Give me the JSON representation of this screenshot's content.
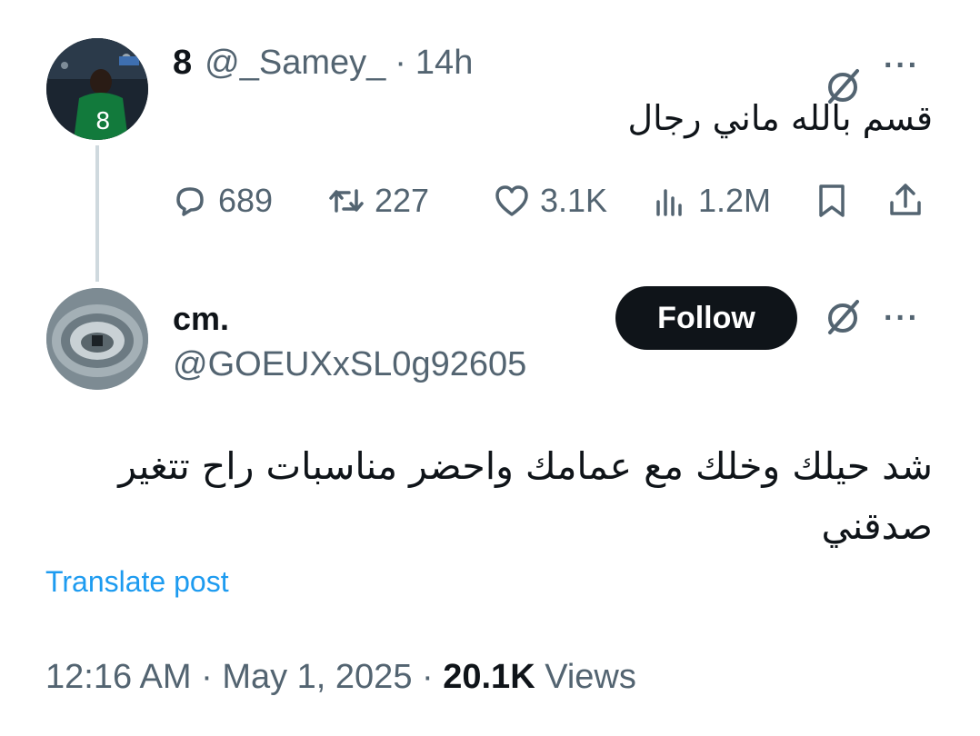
{
  "tweet1": {
    "display_name": "8",
    "handle": "@_Samey_",
    "separator": "·",
    "time": "14h",
    "text": "قسم بالله ماني رجال",
    "replies": "689",
    "retweets": "227",
    "likes": "3.1K",
    "views": "1.2M",
    "more": "···"
  },
  "tweet2": {
    "display_name": "cm.",
    "handle": "@GOEUXxSL0g92605",
    "follow_label": "Follow",
    "more": "···",
    "text": "شد حيلك وخلك مع عمامك واحضر مناسبات راح تتغير صدقني",
    "translate_label": "Translate post",
    "timestamp": "12:16 AM · May 1, 2025 · ",
    "views_count": "20.1K",
    "views_label": " Views"
  },
  "colors": {
    "text_primary": "#0f1419",
    "text_secondary": "#536471",
    "link": "#1d9bf0",
    "thread_line": "#cfd9de"
  },
  "icons": [
    "reply-icon",
    "retweet-icon",
    "like-icon",
    "views-icon",
    "bookmark-icon",
    "share-icon",
    "grok-icon",
    "more-icon"
  ]
}
